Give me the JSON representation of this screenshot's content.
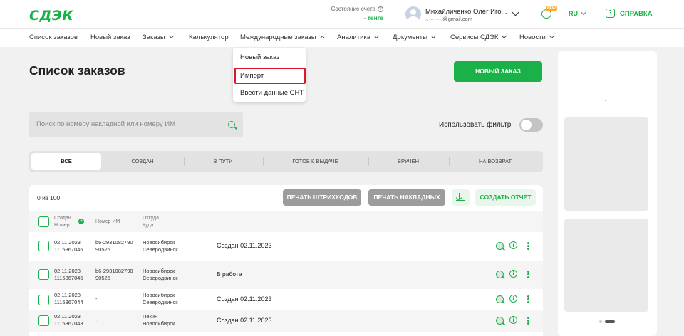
{
  "header": {
    "logo": "СДЭК",
    "balance_label": "Состояние счета",
    "balance_value": "- тенге",
    "user_name": "Михайличенко Олег Иго...",
    "user_email": "·,·······,@gmail.com",
    "new_badge": "NEW",
    "lang": "RU",
    "help": "СПРАВКА"
  },
  "nav": {
    "items": [
      {
        "label": "Список заказов"
      },
      {
        "label": "Новый заказ"
      },
      {
        "label": "Заказы"
      },
      {
        "label": "Калькулятор"
      },
      {
        "label": "Международные заказы"
      },
      {
        "label": "Аналитика"
      },
      {
        "label": "Документы"
      },
      {
        "label": "Сервисы СДЭК"
      },
      {
        "label": "Новости"
      }
    ]
  },
  "dropdown": {
    "items": [
      {
        "label": "Новый заказ"
      },
      {
        "label": "Импорт"
      },
      {
        "label": "Ввести данные СНТ"
      }
    ]
  },
  "page": {
    "title": "Список заказов",
    "new_order_button": "НОВЫЙ ЗАКАЗ",
    "search_placeholder": "Поиск по номеру накладной или номеру ИМ",
    "filter_label": "Использовать фильтр",
    "filter_on": false
  },
  "tabs": [
    {
      "label": "ВСЕ"
    },
    {
      "label": "СОЗДАН"
    },
    {
      "label": "В ПУТИ"
    },
    {
      "label": "ГОТОВ К ВЫДАЧЕ"
    },
    {
      "label": "ВРУЧЕН"
    },
    {
      "label": "НА ВОЗВРАТ"
    }
  ],
  "toolbar": {
    "count": "0 из 100",
    "print_barcodes": "ПЕЧАТЬ ШТРИХКОДОВ",
    "print_waybills": "ПЕЧАТЬ НАКЛАДНЫХ",
    "create_report": "СОЗДАТЬ ОТЧЕТ"
  },
  "table": {
    "headers": {
      "created": "Создан",
      "number": "Номер",
      "im_number": "Номер ИМ",
      "from": "Откуда",
      "to": "Куда"
    },
    "rows": [
      {
        "date": "02.11.2023",
        "number": "1115367046",
        "im_l1": "b6-2931082790",
        "im_l2": "90525",
        "from": "Новосибирск",
        "to": "Северодвинск",
        "status": "Создан",
        "status_date": "02.11.2023"
      },
      {
        "date": "02.11.2023",
        "number": "1115367045",
        "im_l1": "b6-2931082790",
        "im_l2": "90525",
        "from": "Новосибирск",
        "to": "Северодвинск",
        "status": "В работе",
        "status_date": ""
      },
      {
        "date": "02.11.2023",
        "number": "1115367044",
        "im_l1": "-",
        "im_l2": "",
        "from": "Новосибирск",
        "to": "Северодвинск",
        "status": "Создан",
        "status_date": "02.11.2023"
      },
      {
        "date": "02.11.2023",
        "number": "1115367043",
        "im_l1": "-",
        "im_l2": "",
        "from": "Пекин",
        "to": "Новосибирск",
        "status": "Создан",
        "status_date": "02.11.2023"
      }
    ]
  },
  "colors": {
    "brand": "#1ab248",
    "highlight": "#d9182a",
    "disabled_button": "#9c9c9c"
  }
}
